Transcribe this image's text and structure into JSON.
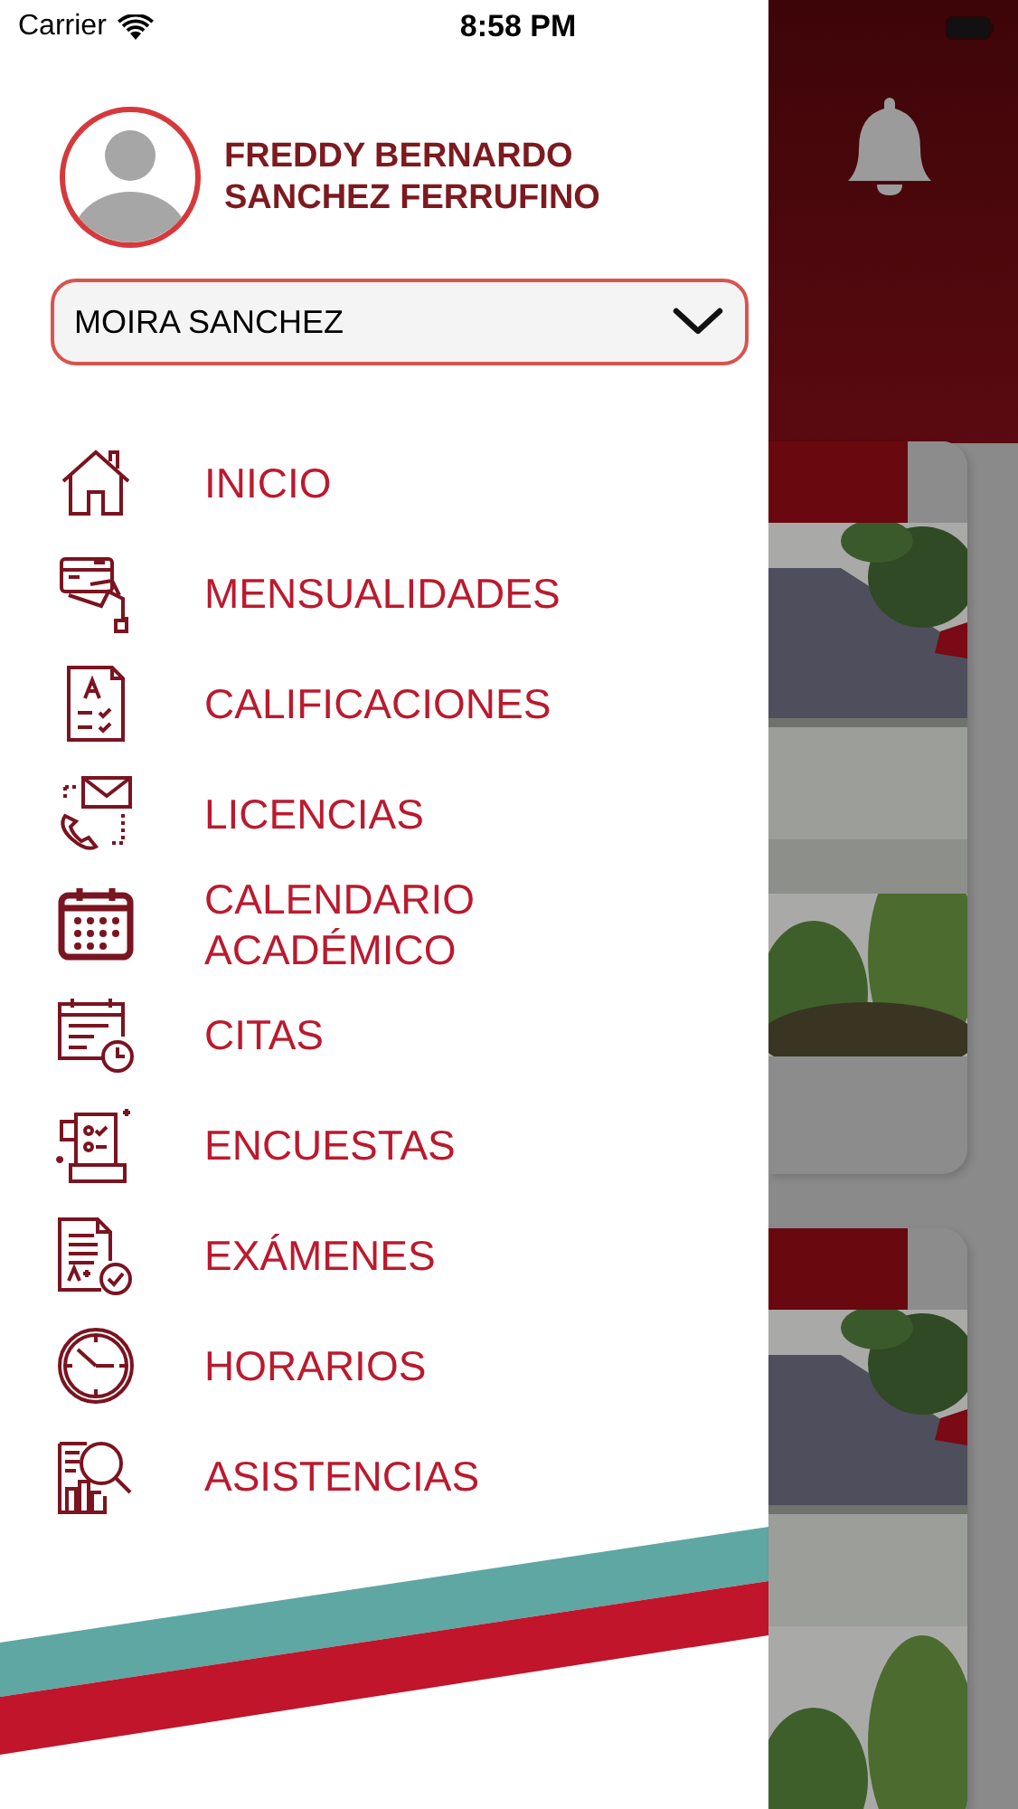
{
  "status_bar": {
    "carrier": "Carrier",
    "time": "8:58 PM"
  },
  "profile": {
    "name": "FREDDY BERNARDO SANCHEZ FERRUFINO"
  },
  "student_selector": {
    "value": "MOIRA SANCHEZ"
  },
  "menu": [
    {
      "label": "INICIO",
      "kind": "home"
    },
    {
      "label": "MENSUALIDADES",
      "kind": "payment"
    },
    {
      "label": "CALIFICACIONES",
      "kind": "grades"
    },
    {
      "label": "LICENCIAS",
      "kind": "contact"
    },
    {
      "label": "CALENDARIO ACADÉMICO",
      "kind": "calendar"
    },
    {
      "label": "CITAS",
      "kind": "appointment"
    },
    {
      "label": "ENCUESTAS",
      "kind": "survey"
    },
    {
      "label": "EXÁMENES",
      "kind": "exam"
    },
    {
      "label": "HORARIOS",
      "kind": "clock"
    },
    {
      "label": "ASISTENCIAS",
      "kind": "attendance"
    }
  ]
}
